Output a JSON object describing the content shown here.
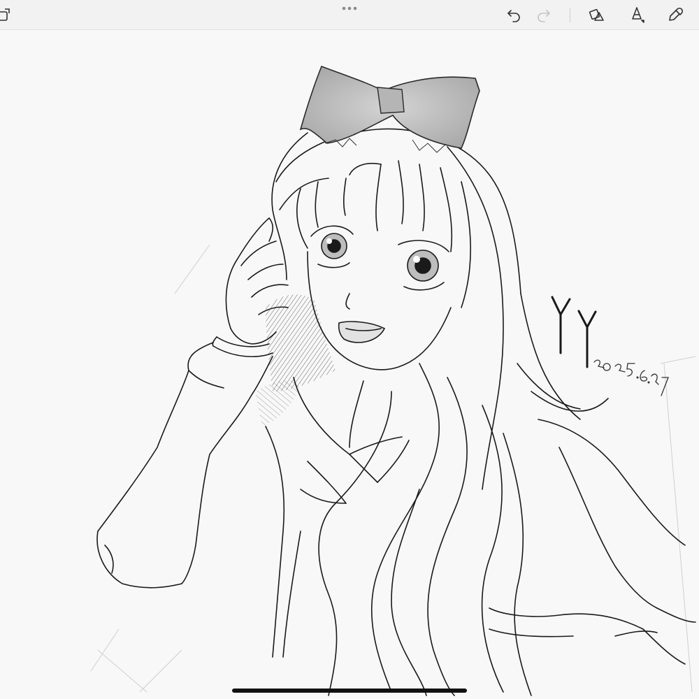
{
  "toolbar": {
    "icons": {
      "left": "layers-icon",
      "more": "more-dots-icon",
      "undo": "undo-icon",
      "redo": "redo-icon",
      "shapes": "shapes-icon",
      "brush": "brush-icon",
      "color": "color-picker-icon"
    },
    "redo_enabled": false
  },
  "artwork": {
    "signature": "YY",
    "date": "2025.6.27",
    "subject": "sketch-girl-with-bow",
    "style": "pencil-sketch-grayscale"
  },
  "colors": {
    "toolbar_bg": "#f2f2f2",
    "canvas_bg": "#f8f8f8",
    "ink": "#1a1a1a",
    "icon": "#333333",
    "icon_disabled": "#c4c4c4"
  }
}
